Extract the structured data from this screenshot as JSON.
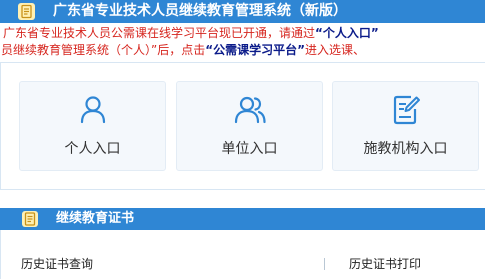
{
  "header": {
    "title": "广东省专业技术人员继续教育管理系统（新版）",
    "icon": "document-icon"
  },
  "notice": {
    "line1_text": "广东省专业技术人员公需课在线学习平台现已开通，请通过",
    "line1_highlight": "“个人入口”",
    "line2_text_a": "员继续教育管理系统（个人）”后，点击",
    "line2_highlight": "“公需课学习平台”",
    "line2_text_b": "进入选课、"
  },
  "entries": [
    {
      "label": "个人入口",
      "icon": "person-icon"
    },
    {
      "label": "单位入口",
      "icon": "group-icon"
    },
    {
      "label": "施教机构入口",
      "icon": "edit-document-icon"
    }
  ],
  "section": {
    "title": "继续教育证书",
    "icon": "document-icon"
  },
  "certificates": {
    "query_link": "历史证书查询",
    "print_link": "历史证书打印"
  },
  "colors": {
    "header_blue": "#2f86d4",
    "notice_red": "#d6261f",
    "highlight_navy": "#0b1b8a",
    "icon_blue": "#2f86d4"
  }
}
